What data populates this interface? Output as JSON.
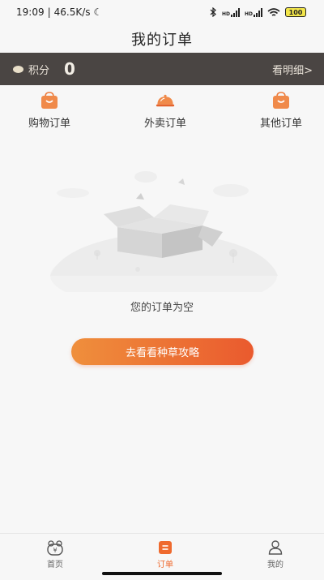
{
  "status_bar": {
    "time": "19:09",
    "speed": "46.5K/s",
    "battery": "100"
  },
  "header": {
    "title": "我的订单"
  },
  "points": {
    "label": "积分",
    "value": "0",
    "detail_link": "看明细>"
  },
  "categories": [
    {
      "label": "购物订单",
      "icon": "shopping-bag-icon"
    },
    {
      "label": "外卖订单",
      "icon": "food-cloche-icon"
    },
    {
      "label": "其他订单",
      "icon": "shopping-bag-icon"
    }
  ],
  "empty_state": {
    "illustration": "empty-box-illustration",
    "message": "您的订单为空",
    "cta_label": "去看看种草攻略"
  },
  "tabs": [
    {
      "label": "首页",
      "icon": "home-wallet-icon",
      "active": false
    },
    {
      "label": "订单",
      "icon": "order-icon",
      "active": true
    },
    {
      "label": "我的",
      "icon": "profile-icon",
      "active": false
    }
  ],
  "colors": {
    "accent": "#ef6a2e",
    "points_bar": "#4a4543",
    "cta_gradient_start": "#ef8f3c",
    "cta_gradient_end": "#ea5a2e",
    "background": "#f7f7f7"
  }
}
